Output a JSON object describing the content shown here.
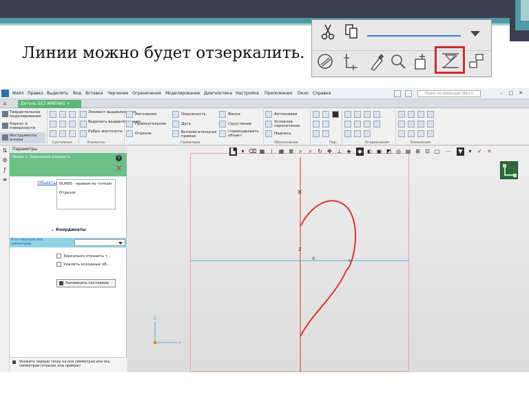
{
  "slide": {
    "title": "Линии можно будет отзеркалить."
  },
  "inset": {
    "row1_icons": [
      "scissors-icon",
      "copy-icon"
    ],
    "row2_icons": [
      "fillet-icon",
      "coordinate-icon",
      "eyedropper-icon",
      "zoom-icon",
      "rebuild-icon",
      "mirror-icon",
      "arrange-icon"
    ],
    "highlighted": "mirror-icon",
    "line_color": "#3b78c9",
    "highlight_color": "#d42a2a"
  },
  "app": {
    "menu": [
      "Файл",
      "Правка",
      "Выделить",
      "Вид",
      "Вставка",
      "Черчение",
      "Ограничения",
      "Моделирование",
      "Диагностика",
      "Настройка",
      "Приложения",
      "Окно",
      "Справка"
    ],
    "search_placeholder": "Поиск по командам (Alt+/)",
    "document_tab": "Деталь БЕЗ ИМЕНИ1",
    "ribbon": {
      "side_items": [
        "Твердотельное моделирование",
        "Каркас и поверхности",
        "Инструменты эскиза"
      ],
      "element_items": [
        "Элемент выдавливания",
        "Вырезать выдавливанием",
        "Ребро жесткости"
      ],
      "geometry_items": [
        "Автолиния",
        "Прямоугольник",
        "Отрезок",
        "Окружность",
        "Дуга",
        "Вспомогательная прямая",
        "Фаска",
        "Скругление",
        "Спроецировать объект"
      ],
      "annotation_items": [
        "Автоосевая",
        "Условное пересечение",
        "Надпись"
      ],
      "groups": [
        "Системная",
        "Элементы",
        "Геометрия",
        "Обозначения",
        "Пар..",
        "Ограничения",
        "Изменение"
      ]
    },
    "panel": {
      "header": "Параметры",
      "command": "Эскиз > Зеркально отразить",
      "objects_label": "Объекты",
      "objects": [
        "NURBS - кривая по точкам",
        "Отрезок"
      ],
      "coords_header": "Координаты",
      "axis_label": "Угол наклона оси симметрии",
      "checkbox1": "Зеркально отразить т...",
      "checkbox2": "Удалить исходные об...",
      "save_state": "Запомнить состояние",
      "hint": "Укажите первую точку на оси симметрии или ось симметрии (отрезок или прямую)"
    },
    "canvas": {
      "curve_color": "#e03030",
      "axis_color": "#5aa9d6",
      "vertical_axis_color": "#e05050",
      "axis_x_label": "X",
      "axis_y_label": "Y",
      "axis_z_label": "Z",
      "axis_y_label2": "Y"
    }
  }
}
